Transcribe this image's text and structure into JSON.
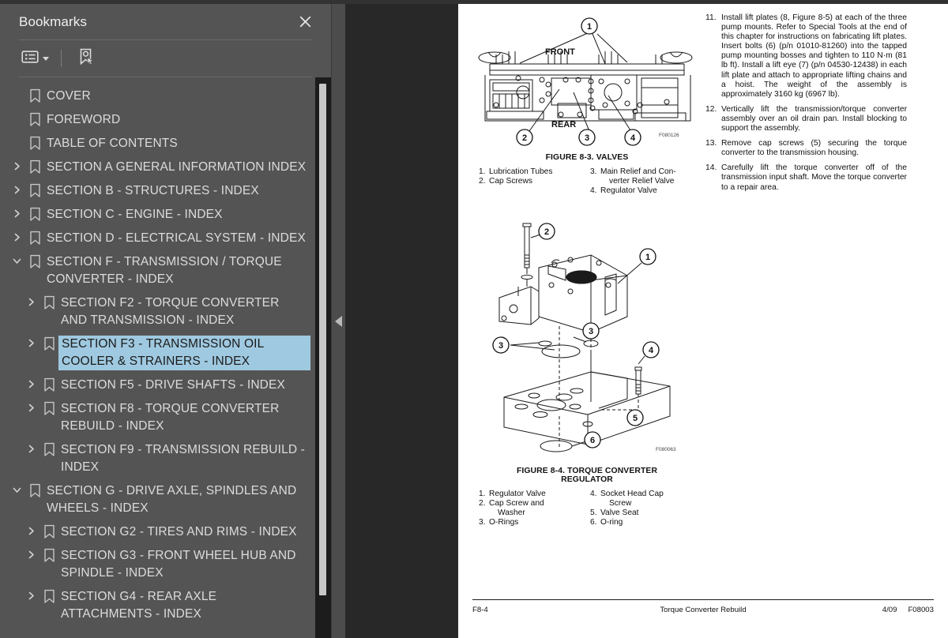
{
  "panel": {
    "title": "Bookmarks",
    "close_icon": "close-icon",
    "toolbar": {
      "options_label": "list-options",
      "options_icon": "list-options-icon",
      "caret_icon": "chevron-down-icon",
      "new_bookmark_icon": "new-bookmark-icon"
    },
    "bookmarks": [
      {
        "label": "COVER",
        "level": 0,
        "twisty": "none",
        "selected": false
      },
      {
        "label": "FOREWORD",
        "level": 0,
        "twisty": "none",
        "selected": false
      },
      {
        "label": "TABLE OF CONTENTS",
        "level": 0,
        "twisty": "none",
        "selected": false
      },
      {
        "label": "SECTION A GENERAL INFORMATION INDEX",
        "level": 0,
        "twisty": "collapsed",
        "selected": false
      },
      {
        "label": "SECTION B - STRUCTURES - INDEX",
        "level": 0,
        "twisty": "collapsed",
        "selected": false
      },
      {
        "label": "SECTION C - ENGINE - INDEX",
        "level": 0,
        "twisty": "collapsed",
        "selected": false
      },
      {
        "label": "SECTION D - ELECTRICAL SYSTEM - INDEX",
        "level": 0,
        "twisty": "collapsed",
        "selected": false
      },
      {
        "label": "SECTION F - TRANSMISSION / TORQUE CONVERTER - INDEX",
        "level": 0,
        "twisty": "expanded",
        "selected": false
      },
      {
        "label": "SECTION F2 - TORQUE CONVERTER AND TRANSMISSION - INDEX",
        "level": 1,
        "twisty": "collapsed",
        "selected": false
      },
      {
        "label": "SECTION F3 - TRANSMISSION OIL COOLER & STRAINERS - INDEX",
        "level": 1,
        "twisty": "collapsed",
        "selected": true
      },
      {
        "label": "SECTION F5 - DRIVE SHAFTS - INDEX",
        "level": 1,
        "twisty": "collapsed",
        "selected": false
      },
      {
        "label": "SECTION F8 - TORQUE CONVERTER REBUILD - INDEX",
        "level": 1,
        "twisty": "collapsed",
        "selected": false
      },
      {
        "label": "SECTION F9 - TRANSMISSION REBUILD - INDEX",
        "level": 1,
        "twisty": "collapsed",
        "selected": false
      },
      {
        "label": "SECTION G - DRIVE AXLE, SPINDLES AND WHEELS - INDEX",
        "level": 0,
        "twisty": "expanded",
        "selected": false
      },
      {
        "label": "SECTION G2 - TIRES AND RIMS - INDEX",
        "level": 1,
        "twisty": "collapsed",
        "selected": false
      },
      {
        "label": "SECTION G3 - FRONT WHEEL HUB AND SPINDLE - INDEX",
        "level": 1,
        "twisty": "collapsed",
        "selected": false
      },
      {
        "label": "SECTION G4 - REAR AXLE ATTACHMENTS - INDEX",
        "level": 1,
        "twisty": "collapsed",
        "selected": false
      }
    ],
    "highlight_color": "#9fc9e0",
    "background_color": "#545454"
  },
  "splitter": {
    "collapse_icon": "collapse-left-arrow-icon"
  },
  "document": {
    "figures": [
      {
        "id": "figure-8-3",
        "caption": "FIGURE 8-3. VALVES",
        "code": "F080126",
        "orientation_labels": [
          "FRONT",
          "REAR"
        ],
        "callouts": [
          "1",
          "2",
          "3",
          "4"
        ],
        "legend_left": [
          {
            "n": "1.",
            "t": "Lubrication Tubes"
          },
          {
            "n": "2.",
            "t": "Cap Screws"
          }
        ],
        "legend_right": [
          {
            "n": "3.",
            "t": "Main Relief and Con-"
          },
          {
            "n": "",
            "t": "verter Relief Valve",
            "indent": true
          },
          {
            "n": "4.",
            "t": "Regulator Valve"
          }
        ]
      },
      {
        "id": "figure-8-4",
        "caption_line1": "FIGURE 8-4. TORQUE CONVERTER",
        "caption_line2": "REGULATOR",
        "code": "F080063",
        "callouts": [
          "1",
          "2",
          "3",
          "3",
          "3",
          "4",
          "5",
          "6"
        ],
        "legend_left": [
          {
            "n": "1.",
            "t": "Regulator Valve"
          },
          {
            "n": "2.",
            "t": "Cap Screw and"
          },
          {
            "n": "",
            "t": "Washer",
            "indent": true
          },
          {
            "n": "3.",
            "t": "O-Rings"
          }
        ],
        "legend_right": [
          {
            "n": "4.",
            "t": "Socket Head Cap"
          },
          {
            "n": "",
            "t": "Screw",
            "indent": true
          },
          {
            "n": "5.",
            "t": "Valve Seat"
          },
          {
            "n": "6.",
            "t": "O-ring"
          }
        ]
      }
    ],
    "instructions": [
      {
        "num": "11.",
        "text": "Install lift plates (8, Figure 8-5) at each of the three pump mounts. Refer to Special Tools at the end of this chapter for instructions on fabricating lift plates. Insert bolts (6) (p/n 01010-81260) into the tapped pump mounting bosses and tighten to 110 N·m (81 lb ft). Install a lift eye (7) (p/n 04530-12438) in each lift plate and attach to appropriate lifting chains and a hoist. The weight of the assembly is approximately 3160 kg (6967 lb)."
      },
      {
        "num": "12.",
        "text": "Vertically lift the transmission/torque converter assembly over an oil drain pan. Install blocking to support the assembly."
      },
      {
        "num": "13.",
        "text": "Remove cap screws (5) securing the torque converter to the transmission housing."
      },
      {
        "num": "14.",
        "text": "Carefully lift the torque converter off of the transmission input shaft. Move the torque converter to a repair area."
      }
    ],
    "footer": {
      "left": "F8-4",
      "center": "Torque Converter Rebuild",
      "right_date": "4/09",
      "right_code": "F08003"
    }
  }
}
